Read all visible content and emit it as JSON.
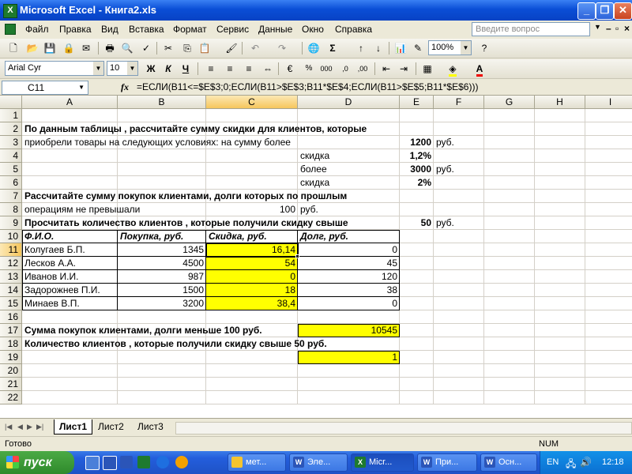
{
  "window": {
    "title": "Microsoft Excel - Книга2.xls",
    "app_icon": "excel-icon"
  },
  "menu": {
    "items": [
      "Файл",
      "Правка",
      "Вид",
      "Вставка",
      "Формат",
      "Сервис",
      "Данные",
      "Окно",
      "Справка"
    ],
    "help_placeholder": "Введите вопрос"
  },
  "toolbar": {
    "zoom": "100%",
    "font": "Arial Cyr",
    "font_size": "10"
  },
  "formula_bar": {
    "name_box": "C11",
    "fx": "fx",
    "formula": "=ЕСЛИ(B11<=$E$3;0;ЕСЛИ(B11>$E$3;B11*$E$4;ЕСЛИ(B11>$E$5;B11*$E$6)))"
  },
  "grid": {
    "columns": [
      "A",
      "B",
      "C",
      "D",
      "E",
      "F",
      "G",
      "H",
      "I"
    ],
    "rows": [
      "1",
      "2",
      "3",
      "4",
      "5",
      "6",
      "7",
      "8",
      "9",
      "10",
      "11",
      "12",
      "13",
      "14",
      "15",
      "16",
      "17",
      "18",
      "19",
      "20",
      "21",
      "22"
    ],
    "texts": {
      "r2": "По данным таблицы , рассчитайте сумму скидки для клиентов, которые",
      "r3": "приобрели товары на следующих условиях: на сумму более",
      "e3": "1200",
      "f3": "руб.",
      "d4": "скидка",
      "e4": "1,2%",
      "d5": "более",
      "e5": "3000",
      "f5": "руб.",
      "d6": "скидка",
      "e6": "2%",
      "r7": "Рассчитайте сумму покупок клиентами, долги которых по прошлым",
      "r8": "операциям не превышали",
      "c8": "100",
      "d8": "руб.",
      "r9": "Просчитать количество клиентов , которые получили скидку свыше",
      "e9": "50",
      "f9": "руб.",
      "r17": "Сумма покупок клиентами, долги меньше 100 руб.",
      "d17": "10545",
      "r18": "Количество клиентов , которые получили скидку свыше 50 руб.",
      "d19": "1"
    },
    "table": {
      "headers": [
        "Ф.И.О.",
        "Покупка, руб.",
        "Скидка, руб.",
        "Долг, руб."
      ],
      "rows": [
        {
          "name": "Колугаев Б.П.",
          "purchase": "1345",
          "discount": "16,14",
          "debt": "0"
        },
        {
          "name": "Лесков А.А.",
          "purchase": "4500",
          "discount": "54",
          "debt": "45"
        },
        {
          "name": "Иванов И.И.",
          "purchase": "987",
          "discount": "0",
          "debt": "120"
        },
        {
          "name": "Задорожнев П.И.",
          "purchase": "1500",
          "discount": "18",
          "debt": "38"
        },
        {
          "name": "Минаев В.П.",
          "purchase": "3200",
          "discount": "38,4",
          "debt": "0"
        }
      ]
    }
  },
  "sheets": [
    "Лист1",
    "Лист2",
    "Лист3"
  ],
  "status": {
    "left": "Готово",
    "num": "NUM"
  },
  "taskbar": {
    "start": "пуск",
    "buttons": [
      "мет...",
      "Эле...",
      "Micr...",
      "При...",
      "Осн..."
    ],
    "lang": "EN",
    "clock": "12:18"
  },
  "colors": {
    "highlight": "#FFFF00",
    "title_bar": "#0A4ED6",
    "start_green": "#2F8A2B"
  }
}
